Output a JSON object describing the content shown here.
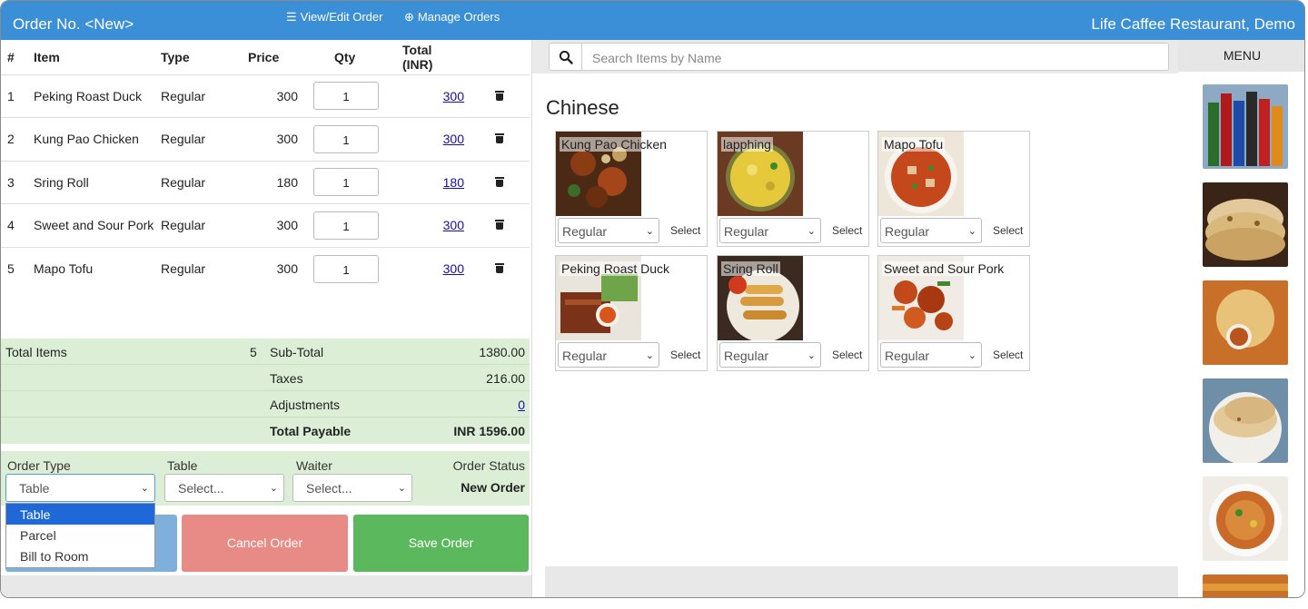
{
  "header": {
    "title": "Order No. <New>",
    "view_edit": "View/Edit Order",
    "manage": "Manage Orders",
    "brand": "Life Caffee Restaurant, Demo"
  },
  "table": {
    "headers": {
      "num": "#",
      "item": "Item",
      "type": "Type",
      "price": "Price",
      "qty": "Qty",
      "total": "Total (INR)"
    },
    "rows": [
      {
        "num": "1",
        "item": "Peking Roast Duck",
        "type": "Regular",
        "price": "300",
        "qty": "1",
        "total": "300"
      },
      {
        "num": "2",
        "item": "Kung Pao Chicken",
        "type": "Regular",
        "price": "300",
        "qty": "1",
        "total": "300"
      },
      {
        "num": "3",
        "item": "Sring Roll",
        "type": "Regular",
        "price": "180",
        "qty": "1",
        "total": "180"
      },
      {
        "num": "4",
        "item": "Sweet and Sour Pork",
        "type": "Regular",
        "price": "300",
        "qty": "1",
        "total": "300"
      },
      {
        "num": "5",
        "item": "Mapo Tofu",
        "type": "Regular",
        "price": "300",
        "qty": "1",
        "total": "300"
      }
    ]
  },
  "summary": {
    "total_items_label": "Total Items",
    "total_items": "5",
    "subtotal_label": "Sub-Total",
    "subtotal": "1380.00",
    "taxes_label": "Taxes",
    "taxes": "216.00",
    "adjustments_label": "Adjustments",
    "adjustments": "0",
    "total_payable_label": "Total Payable",
    "total_payable": "INR 1596.00"
  },
  "order": {
    "order_type_label": "Order Type",
    "order_type_value": "Table",
    "table_label": "Table",
    "table_value": "Select...",
    "waiter_label": "Waiter",
    "waiter_value": "Select...",
    "status_label": "Order Status",
    "status_value": "New Order",
    "type_options": [
      "Table",
      "Parcel",
      "Bill to Room"
    ]
  },
  "buttons": {
    "cancel": "Cancel Order",
    "save": "Save Order"
  },
  "colors": {
    "header": "#3a8fd6",
    "summary_bg": "#dcefd6",
    "cancel": "#e88a85",
    "save": "#5cb85c",
    "blue_btn": "#7fb0db",
    "link": "#1a0dab",
    "dropdown_active": "#1e68d8"
  },
  "search": {
    "placeholder": "Search Items by Name"
  },
  "category": "Chinese",
  "cards": [
    {
      "name": "Kung Pao Chicken",
      "variant": "Regular",
      "select": "Select"
    },
    {
      "name": "lapphing",
      "variant": "Regular",
      "select": "Select"
    },
    {
      "name": "Mapo Tofu",
      "variant": "Regular",
      "select": "Select"
    },
    {
      "name": "Peking Roast Duck",
      "variant": "Regular",
      "select": "Select"
    },
    {
      "name": "Sring Roll",
      "variant": "Regular",
      "select": "Select"
    },
    {
      "name": "Sweet and Sour Pork",
      "variant": "Regular",
      "select": "Select"
    }
  ],
  "menu": {
    "label": "MENU"
  },
  "icons": [
    "search-icon",
    "trash-icon",
    "list-icon",
    "plus-circle-icon",
    "chevron-down-icon"
  ]
}
